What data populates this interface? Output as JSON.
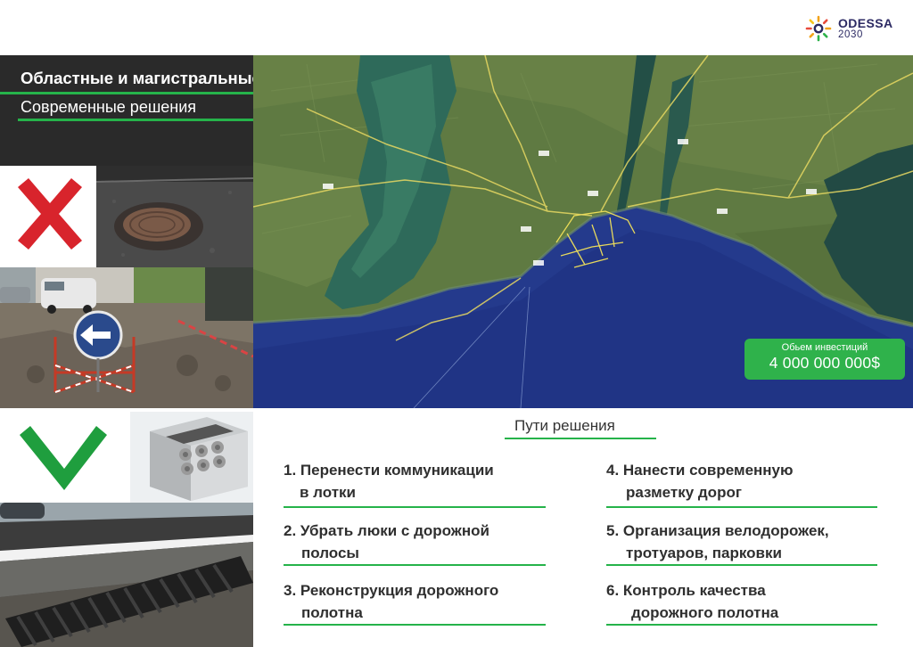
{
  "logo": {
    "name": "ODESSA",
    "year": "2030"
  },
  "header": {
    "title": "Областные и магистральные дороги",
    "subtitle": "Современные решения"
  },
  "investment": {
    "label": "Обьем инвестиций",
    "value": "4 000 000 000$"
  },
  "solutions": {
    "title": "Пути решения",
    "items": [
      {
        "line1": "1. Перенести коммуникации",
        "line2": "в лотки"
      },
      {
        "line1": "2. Убрать люки с дорожной",
        "line2": "полосы"
      },
      {
        "line1": "3. Реконструкция дорожного",
        "line2": "полотна"
      },
      {
        "line1": "4. Нанести современную",
        "line2": "разметку дорог"
      },
      {
        "line1": "5. Организация велодорожек,",
        "line2": "тротуаров, парковки"
      },
      {
        "line1": "6. Контроль качества",
        "line2": "дорожного полотна"
      }
    ]
  },
  "colors": {
    "accent": "#25b34a",
    "cross": "#d8242c",
    "check": "#1f9e3e",
    "panel": "#2a2a2a",
    "sea": "#243a8c"
  },
  "icons": {
    "bad": "cross-icon",
    "good": "check-icon",
    "logo": "sun-logo-icon"
  }
}
